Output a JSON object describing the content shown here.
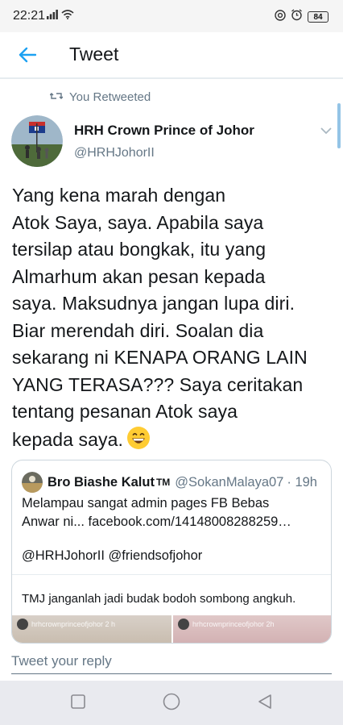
{
  "status_bar": {
    "time": "22:21",
    "battery": "84",
    "icons": [
      "signal-icon",
      "wifi-icon",
      "at-sign-icon",
      "alarm-icon",
      "battery-icon"
    ]
  },
  "app_bar": {
    "title": "Tweet",
    "back_icon": "arrow-left-icon"
  },
  "tweet": {
    "context": "You Retweeted",
    "author_name": "HRH Crown Prince of Johor",
    "author_handle": "@HRHJohorII",
    "text": "Yang kena marah dengan\nAtok Saya, saya. Apabila saya\ntersilap atau bongkak, itu yang\nAlmarhum akan pesan kepada\nsaya. Maksudnya jangan lupa diri.\nBiar merendah diri. Soalan dia\nsekarang ni KENAPA ORANG LAIN\nYANG TERASA??? Saya ceritakan\ntentang pesanan Atok saya\nkepada saya.",
    "emoji": "grinning-face-icon"
  },
  "quoted_tweet": {
    "author_name": "Bro Biashe Kalut",
    "verified_mark": "TM",
    "author_handle": "@SokanMalaya07",
    "time": "· 19h",
    "text_line1": "Melampau sangat admin pages FB Bebas",
    "text_line2": "Anwar ni... facebook.com/14148008288259…",
    "mentions": "@HRHJohorII @friendsofjohor",
    "inner_text": "TMJ janganlah jadi budak bodoh sombong angkuh.",
    "media_labels": [
      "hrhcrownprinceofjohor 2 h",
      "hrhcrownprinceofjohor 2h"
    ]
  },
  "reply": {
    "placeholder": "Tweet your reply"
  },
  "nav_bar": {
    "buttons": [
      "square-icon",
      "circle-icon",
      "triangle-back-icon"
    ]
  },
  "colors": {
    "accent": "#1da1f2",
    "secondary_text": "#657786",
    "border": "#ccd6dd"
  }
}
